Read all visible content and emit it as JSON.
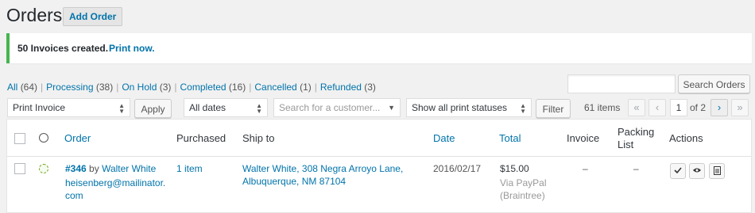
{
  "page": {
    "title": "Orders",
    "add_button": "Add Order"
  },
  "notice": {
    "text": "50 Invoices created.",
    "link": "Print now."
  },
  "filters": [
    {
      "label": "All",
      "count": "(64)"
    },
    {
      "label": "Processing",
      "count": "(38)"
    },
    {
      "label": "On Hold",
      "count": "(3)"
    },
    {
      "label": "Completed",
      "count": "(16)"
    },
    {
      "label": "Cancelled",
      "count": "(1)"
    },
    {
      "label": "Refunded",
      "count": "(3)"
    }
  ],
  "search": {
    "value": "",
    "button": "Search Orders"
  },
  "toolbar": {
    "bulk_action": "Print Invoice",
    "apply": "Apply",
    "dates": "All dates",
    "customer_placeholder": "Search for a customer...",
    "print_status": "Show all print statuses",
    "filter": "Filter",
    "items_count": "61 items",
    "current_page": "1",
    "of_pages": "of 2",
    "first": "«",
    "prev": "‹",
    "next": "›",
    "last": "»"
  },
  "table": {
    "headers": {
      "order": "Order",
      "purchased": "Purchased",
      "ship_to": "Ship to",
      "date": "Date",
      "total": "Total",
      "invoice": "Invoice",
      "packing_line1": "Packing",
      "packing_line2": "List",
      "actions": "Actions"
    },
    "rows": [
      {
        "order_number": "#346",
        "by": "by",
        "customer": "Walter White",
        "email_line1": "heisenberg@mailinator.",
        "email_line2": "com",
        "purchased": "1 item",
        "ship_line1": "Walter White, 308 Negra Arroyo Lane,",
        "ship_line2": "Albuquerque, NM 87104",
        "date": "2016/02/17",
        "total": "$15.00",
        "via_line1": "Via PayPal",
        "via_line2": "(Braintree)",
        "invoice": "–",
        "packing": "–"
      }
    ]
  },
  "icons": {
    "complete": "checkmark-icon",
    "view": "eye-icon",
    "invoice": "document-icon"
  },
  "colors": {
    "link": "#0073aa",
    "notice_border": "#46b450",
    "status_processing": "#73a724"
  }
}
